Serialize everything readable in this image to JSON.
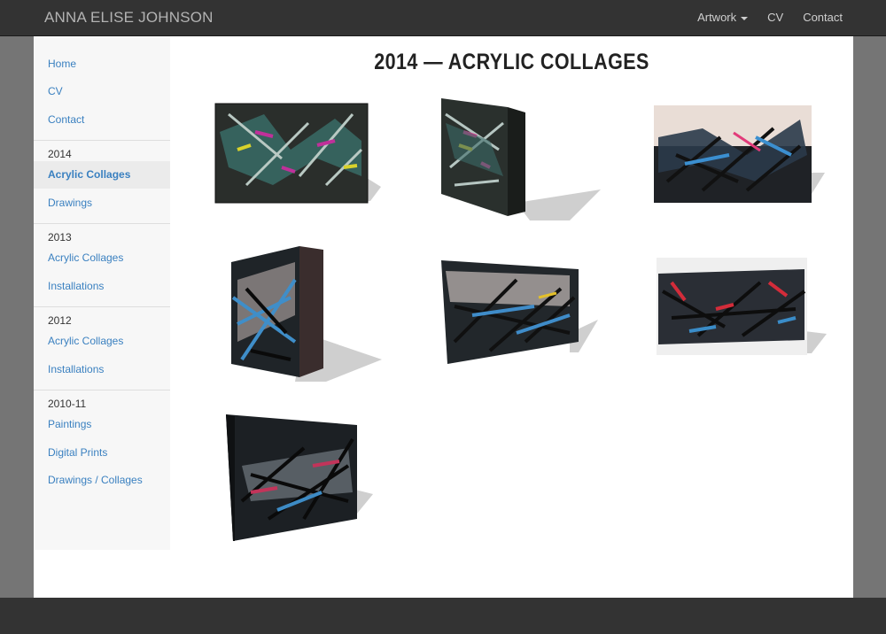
{
  "brand": "ANNA ELISE JOHNSON",
  "nav": {
    "artwork": "Artwork",
    "cv": "CV",
    "contact": "Contact"
  },
  "sidebar": {
    "home": "Home",
    "cv": "CV",
    "contact": "Contact",
    "years": [
      {
        "year": "2014",
        "items": [
          "Acrylic Collages",
          "Drawings"
        ],
        "active_item": "Acrylic Collages"
      },
      {
        "year": "2013",
        "items": [
          "Acrylic Collages",
          "Installations"
        ]
      },
      {
        "year": "2012",
        "items": [
          "Acrylic Collages",
          "Installations"
        ]
      },
      {
        "year": "2010-11",
        "items": [
          "Paintings",
          "Digital Prints",
          "Drawings / Collages"
        ]
      }
    ]
  },
  "page_title": "2014 — ACRYLIC COLLAGES",
  "colors": {
    "link": "#3a80c0",
    "navbar": "#333333",
    "background": "#757575"
  }
}
